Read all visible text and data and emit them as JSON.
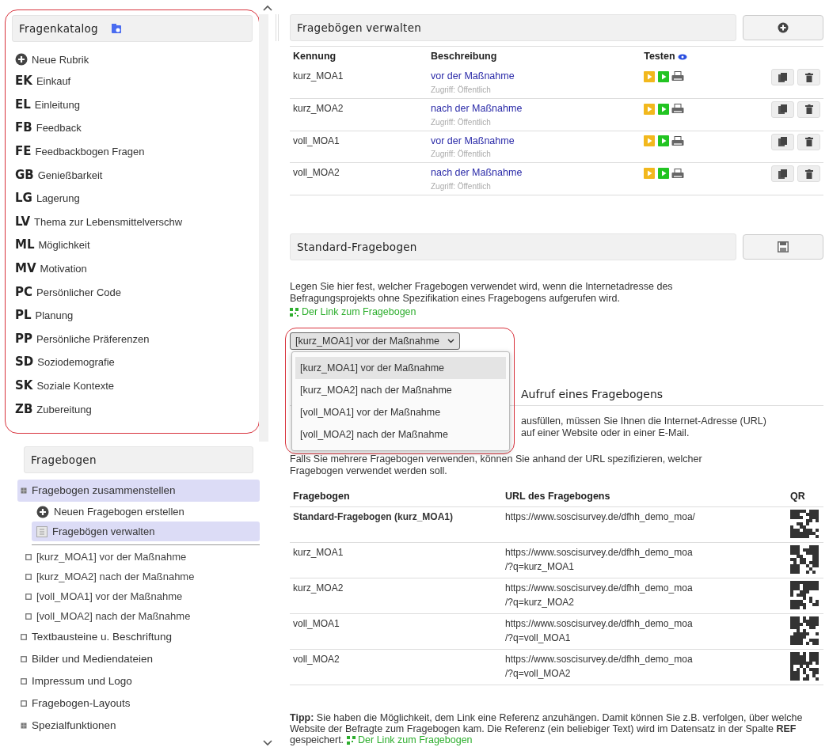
{
  "catalog": {
    "title": "Fragenkatalog",
    "new_item": "Neue Rubrik",
    "items": [
      {
        "code": "EK",
        "label": "Einkauf"
      },
      {
        "code": "EL",
        "label": "Einleitung"
      },
      {
        "code": "FB",
        "label": "Feedback"
      },
      {
        "code": "FE",
        "label": "Feedbackbogen Fragen"
      },
      {
        "code": "GB",
        "label": "Genießbarkeit"
      },
      {
        "code": "LG",
        "label": "Lagerung"
      },
      {
        "code": "LV",
        "label": "Thema zur Lebensmittelverschw"
      },
      {
        "code": "ML",
        "label": "Möglichkeit"
      },
      {
        "code": "MV",
        "label": "Motivation"
      },
      {
        "code": "PC",
        "label": "Persönlicher Code"
      },
      {
        "code": "PL",
        "label": "Planung"
      },
      {
        "code": "PP",
        "label": "Persönliche Präferenzen"
      },
      {
        "code": "SD",
        "label": "Soziodemografie"
      },
      {
        "code": "SK",
        "label": "Soziale Kontexte"
      },
      {
        "code": "ZB",
        "label": "Zubereitung"
      }
    ]
  },
  "questionnaire_nav": {
    "title": "Fragebogen",
    "items": [
      {
        "label": "Fragebogen zusammenstellen",
        "expanded": true,
        "selected": true,
        "children": [
          {
            "kind": "action",
            "label": "Neuen Fragebogen erstellen",
            "selected": false
          },
          {
            "kind": "page",
            "label": "Fragebögen verwalten",
            "selected": true
          },
          {
            "kind": "questionnaire",
            "label": "[kurz_MOA1] vor der Maßnahme",
            "selected": false
          },
          {
            "kind": "questionnaire",
            "label": "[kurz_MOA2] nach der Maßnahme",
            "selected": false
          },
          {
            "kind": "questionnaire",
            "label": "[voll_MOA1] vor der Maßnahme",
            "selected": false
          },
          {
            "kind": "questionnaire",
            "label": "[voll_MOA2] nach der Maßnahme",
            "selected": false
          }
        ]
      },
      {
        "label": "Textbausteine u. Beschriftung",
        "expanded": false,
        "selected": false
      },
      {
        "label": "Bilder und Mediendateien",
        "expanded": false,
        "selected": false
      },
      {
        "label": "Impressum und Logo",
        "expanded": false,
        "selected": false
      },
      {
        "label": "Fragebogen-Layouts",
        "expanded": false,
        "selected": false
      },
      {
        "label": "Spezialfunktionen",
        "expanded": true,
        "selected": false
      }
    ]
  },
  "manage": {
    "title": "Fragebögen verwalten",
    "columns": [
      "Kennung",
      "Beschreibung",
      "Testen"
    ],
    "rows": [
      {
        "id": "kurz_MOA1",
        "description": "vor der Maßnahme",
        "access": "Zugriff: Öffentlich"
      },
      {
        "id": "kurz_MOA2",
        "description": "nach der Maßnahme",
        "access": "Zugriff: Öffentlich"
      },
      {
        "id": "voll_MOA1",
        "description": "vor der Maßnahme",
        "access": "Zugriff: Öffentlich"
      },
      {
        "id": "voll_MOA2",
        "description": "nach der Maßnahme",
        "access": "Zugriff: Öffentlich"
      }
    ]
  },
  "standard": {
    "title": "Standard-Fragebogen",
    "text": "Legen Sie hier fest, welcher Fragebogen verwendet wird, wenn die Internetadresse des Befragungsprojekts ohne Spezifikation eines Fragebogens aufgerufen wird.",
    "link": "Der Link zum Fragebogen",
    "select": {
      "value": "[kurz_MOA1] vor der Maßnahme",
      "open": true,
      "options": [
        {
          "label": "[kurz_MOA1] vor der Maßnahme",
          "selected": true
        },
        {
          "label": "[kurz_MOA2] nach der Maßnahme",
          "selected": false
        },
        {
          "label": "[voll_MOA1] vor der Maßnahme",
          "selected": false
        },
        {
          "label": "[voll_MOA2] nach der Maßnahme",
          "selected": false
        }
      ]
    }
  },
  "call": {
    "title": "Aufruf eines Fragebogens",
    "text_fragments": [
      "ausfüllen, müssen Sie Ihnen die Internet-Adresse (URL)",
      "auf einer Website oder in einer E-Mail."
    ],
    "text": "Falls Sie mehrere Fragebogen verwenden, können Sie anhand der URL spezifizieren, welcher Fragebogen verwendet werden soll.",
    "columns": [
      "Fragebogen",
      "URL des Fragebogens",
      "QR"
    ],
    "rows": [
      {
        "name": "Standard-Fragebogen (kurz_MOA1)",
        "default": true,
        "url_lines": [
          "https://www.soscisurvey.de/dfhh_demo_moa/"
        ]
      },
      {
        "name": "kurz_MOA1",
        "default": false,
        "url_lines": [
          "https://www.soscisurvey.de/dfhh_demo_moa",
          "/?q=kurz_MOA1"
        ]
      },
      {
        "name": "kurz_MOA2",
        "default": false,
        "url_lines": [
          "https://www.soscisurvey.de/dfhh_demo_moa",
          "/?q=kurz_MOA2"
        ]
      },
      {
        "name": "voll_MOA1",
        "default": false,
        "url_lines": [
          "https://www.soscisurvey.de/dfhh_demo_moa",
          "/?q=voll_MOA1"
        ]
      },
      {
        "name": "voll_MOA2",
        "default": false,
        "url_lines": [
          "https://www.soscisurvey.de/dfhh_demo_moa",
          "/?q=voll_MOA2"
        ]
      }
    ]
  },
  "tip": {
    "text": "**Tipp:** Sie haben die Möglichkeit, dem Link eine Referenz anzuhängen. Damit können Sie z.B. verfolgen, über welche Website der Befragte zum Fragebogen kam. Die Referenz (ein beliebiger Text) wird im Datensatz in der Spalte **REF** gespeichert.",
    "link": "Der Link zum Fragebogen"
  }
}
